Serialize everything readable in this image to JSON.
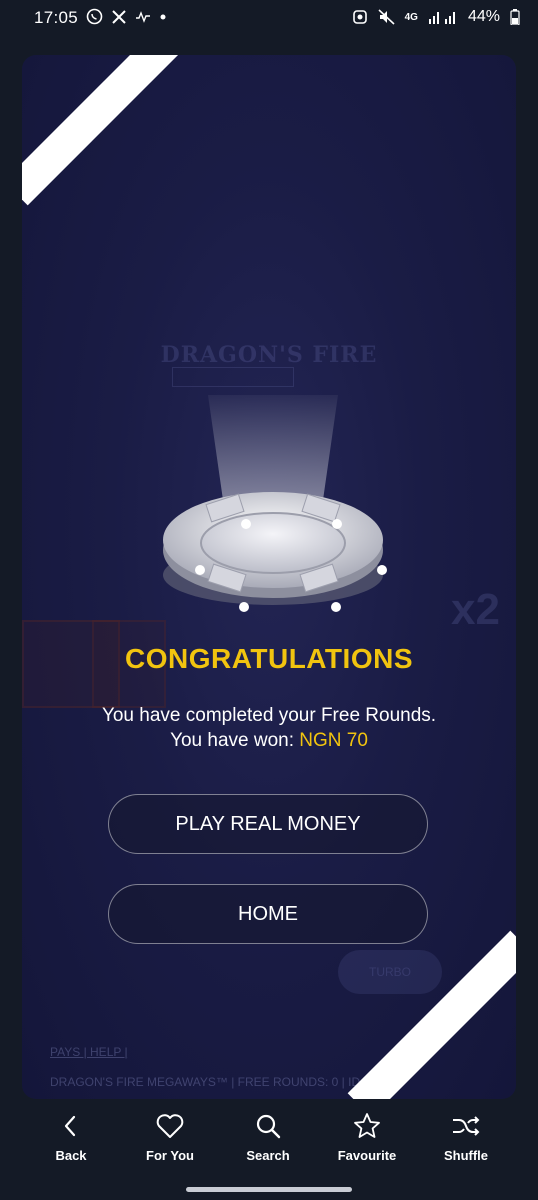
{
  "status_bar": {
    "time": "17:05",
    "network": "4G",
    "battery": "44%",
    "icons": [
      "whatsapp-icon",
      "x-icon",
      "voicemail-icon",
      "dot-icon",
      "recycle-icon",
      "mute-icon",
      "signal-icon",
      "battery-icon"
    ]
  },
  "game": {
    "background_title": "DRAGON'S FIRE",
    "background_multiplier": "x2",
    "background_links": "PAYS | HELP |",
    "background_footer": "DRAGON'S FIRE MEGAWAYS™ | FREE ROUNDS: 0 | ID: 7",
    "background_turbo": "TURBO",
    "accent_color": "#f1c40f"
  },
  "popup": {
    "title": "CONGRATULATIONS",
    "line1": "You have completed your Free Rounds.",
    "line2_prefix": "You have won: ",
    "line2_amount": "NGN 70",
    "play_real_money_label": "PLAY REAL MONEY",
    "home_label": "HOME"
  },
  "bottom_nav": {
    "items": [
      {
        "label": "Back",
        "icon": "chevron-left-icon"
      },
      {
        "label": "For You",
        "icon": "heart-icon"
      },
      {
        "label": "Search",
        "icon": "search-icon"
      },
      {
        "label": "Favourite",
        "icon": "star-icon"
      },
      {
        "label": "Shuffle",
        "icon": "shuffle-icon"
      }
    ]
  }
}
